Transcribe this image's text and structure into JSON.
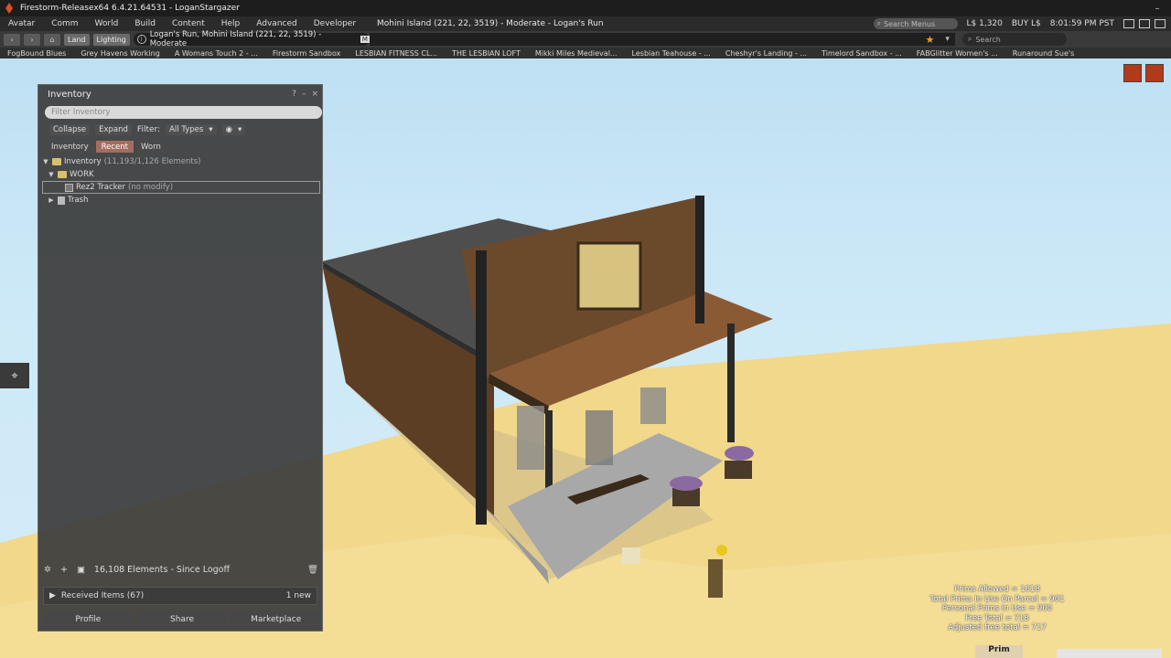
{
  "window": {
    "title": "Firestorm-Releasex64 6.4.21.64531 - LoganStargazer"
  },
  "menubar": {
    "menus": [
      "Avatar",
      "Comm",
      "World",
      "Build",
      "Content",
      "Help",
      "Advanced",
      "Developer"
    ],
    "location": "Mohini Island (221, 22, 3519) - Moderate - Logan's Run",
    "search_placeholder": "Search Menus",
    "balance": "L$ 1,320",
    "buy_label": "BUY L$",
    "clock": "8:01:59 PM PST"
  },
  "navbar": {
    "land_label": "Land",
    "lighting_label": "Lighting",
    "url": "Logan's Run, Mohini Island (221, 22, 3519) - Moderate",
    "maturity_badge": "M",
    "search_placeholder": "Search"
  },
  "favorites": [
    "FogBound Blues",
    "Grey Havens Working",
    "A Womans Touch 2 - ...",
    "Firestorm Sandbox",
    "LESBIAN FITNESS CL...",
    "THE LESBIAN LOFT",
    "Mikki Miles Medieval...",
    "Lesbian Teahouse - ...",
    "Cheshyr's Landing - ...",
    "Timelord Sandbox - ...",
    "FABGlitter Women's ...",
    "Runaround Sue's"
  ],
  "inventory": {
    "title": "Inventory",
    "help": "?",
    "minimize": "–",
    "close": "×",
    "filter_placeholder": "Filter Inventory",
    "collapse_label": "Collapse",
    "expand_label": "Expand",
    "filter_label": "Filter:",
    "types_value": "All Types",
    "tabs": [
      "Inventory",
      "Recent",
      "Worn"
    ],
    "active_tab": "Recent",
    "tree": {
      "root_label": "Inventory",
      "root_count": "(11,193/1,126 Elements)",
      "work_label": "WORK",
      "item_label": "Rez2 Tracker",
      "item_suffix": "(no modify)",
      "trash_label": "Trash"
    },
    "status": "16,108 Elements  - Since Logoff",
    "received_label": "Received Items (67)",
    "received_new": "1 new",
    "buttons": [
      "Profile",
      "Share",
      "Marketplace"
    ]
  },
  "primstats": [
    "Prims Allowed = 1618",
    "Total Prims In Use On Parcel = 901",
    "Personal Prims In Use = 900",
    "Free Total = 718",
    "Adjusted free total = 717"
  ],
  "bottom_button": "Prim",
  "colors": {
    "active_tab": "#a26e60",
    "sky": "#c8e6f5",
    "sand": "#f2d98a",
    "favorite_star": "#f0a020"
  }
}
